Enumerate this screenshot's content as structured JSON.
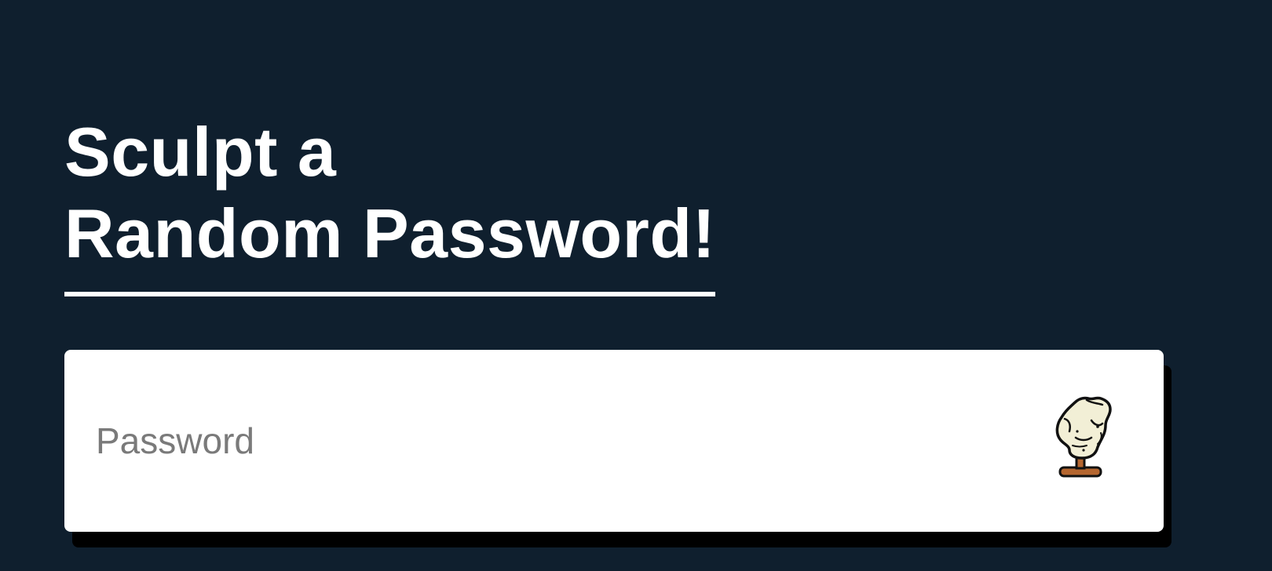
{
  "title": {
    "line1": "Sculpt a",
    "line2": "Random Password!"
  },
  "password_field": {
    "placeholder": "Password",
    "value": ""
  },
  "generate_button": {
    "icon": "sculpture-torso-icon"
  },
  "colors": {
    "background": "#0f1f2e",
    "title_text": "#ffffff",
    "field_background": "#ffffff",
    "field_shadow": "#000000",
    "placeholder_text": "#7a7a7a",
    "statue_marble": "#f2efd6",
    "statue_base": "#b5662f"
  }
}
